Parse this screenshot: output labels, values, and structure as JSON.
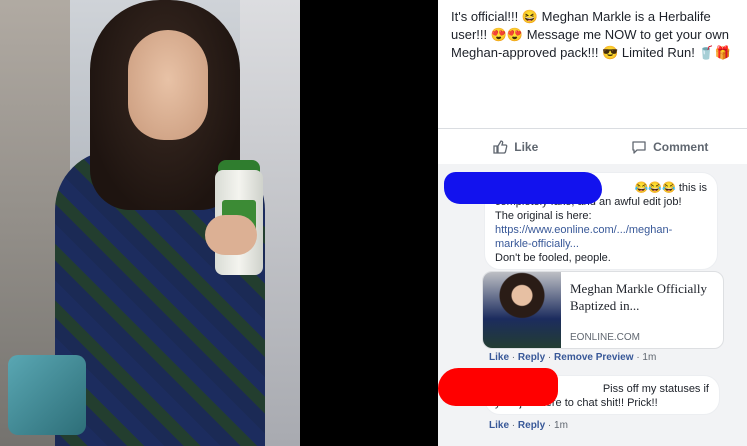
{
  "post": {
    "text_line1": "It's official!!! 😆 Meghan Markle is a Herbalife",
    "text_line2": "user!!! 😍😍 Message me NOW to get your own",
    "text_line3": "Meghan-approved pack!!! 😎 Limited Run! 🥤🎁",
    "like_label": "Like",
    "comment_label": "Comment"
  },
  "comment1": {
    "line1": "😂😂😂 this is",
    "line2": "completely fake, and an awful edit job!",
    "line3": "The original is here:",
    "link1": "https://www.eonline.com/.../meghan-",
    "link2": "markle-officially...",
    "line4": "Don't be fooled, people.",
    "card_title": "Meghan Markle Officially Baptized in...",
    "card_domain": "EONLINE.COM",
    "like": "Like",
    "reply": "Reply",
    "remove_preview": "Remove Preview",
    "time": "1m"
  },
  "comment2": {
    "line1": "Piss off my statuses if",
    "line2": "your just here to chat shit!! Prick!!",
    "like": "Like",
    "reply": "Reply",
    "time": "1m"
  },
  "colors": {
    "link": "#385898",
    "redact_blue": "#1212ee",
    "redact_red": "#ff0000"
  }
}
